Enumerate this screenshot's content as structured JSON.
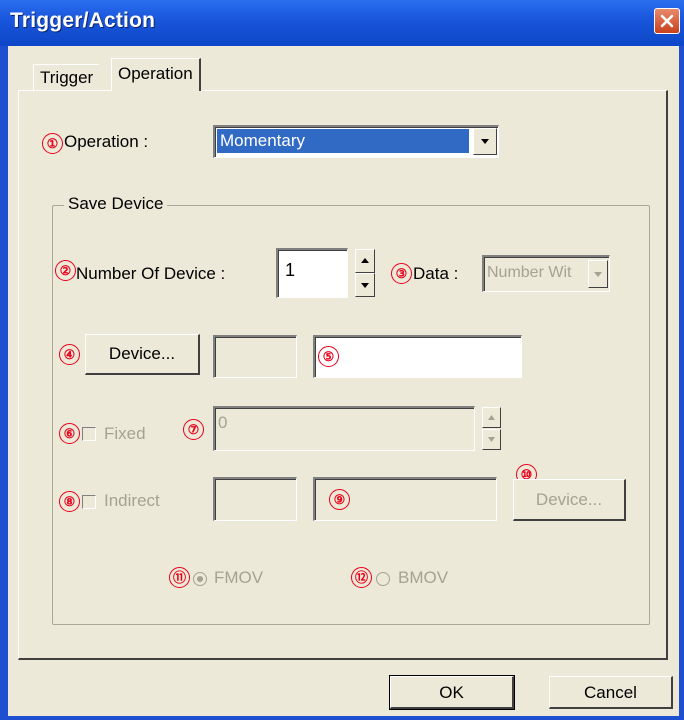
{
  "window": {
    "title": "Trigger/Action"
  },
  "tabs": [
    {
      "label": "Trigger"
    },
    {
      "label": "Operation"
    }
  ],
  "markers": [
    "①",
    "②",
    "③",
    "④",
    "⑤",
    "⑥",
    "⑦",
    "⑧",
    "⑨",
    "⑩",
    "⑪",
    "⑫"
  ],
  "operation": {
    "label": "Operation :",
    "value": "Momentary"
  },
  "save_device": {
    "title": "Save Device",
    "number_of_device": {
      "label": "Number Of Device :",
      "value": "1"
    },
    "data": {
      "label": "Data :",
      "value": "Number Wit"
    },
    "device_button": "Device...",
    "device_code": "",
    "device_address": "",
    "fixed": {
      "label": "Fixed",
      "value": "0",
      "checked": false
    },
    "indirect": {
      "label": "Indirect",
      "code": "",
      "address": "",
      "device_button": "Device...",
      "checked": false
    },
    "fmov": {
      "label": "FMOV",
      "selected": true
    },
    "bmov": {
      "label": "BMOV",
      "selected": false
    }
  },
  "buttons": {
    "ok": "OK",
    "cancel": "Cancel"
  },
  "colors": {
    "title_bar": "#1a57dc",
    "selection": "#316ac5",
    "marker_red": "#e8001a",
    "face": "#ece9d8"
  }
}
